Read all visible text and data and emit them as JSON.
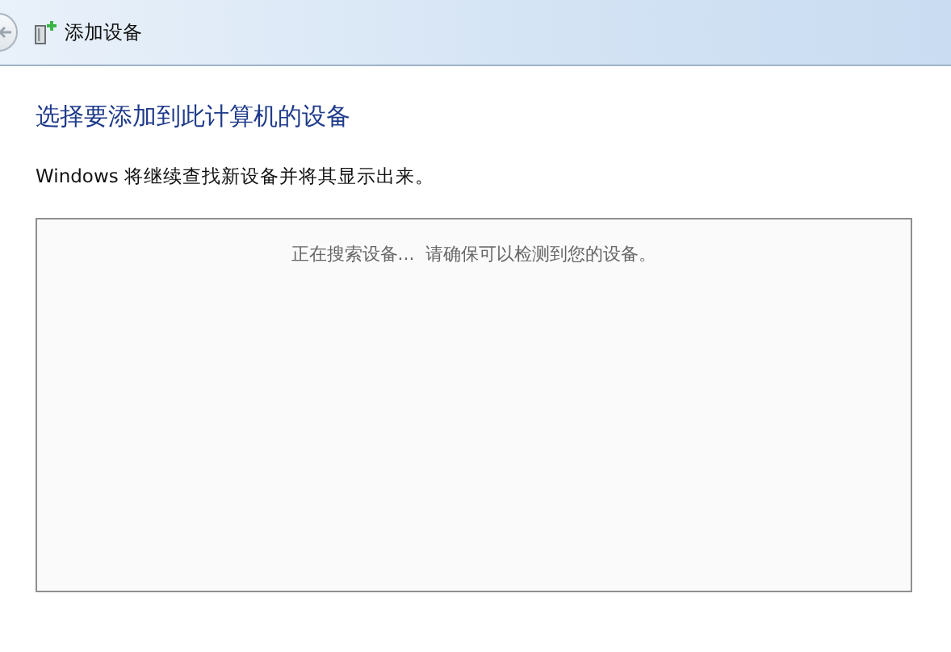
{
  "window": {
    "title": "添加设备"
  },
  "heading": "选择要添加到此计算机的设备",
  "description": "Windows 将继续查找新设备并将其显示出来。",
  "device_list": {
    "status": "正在搜索设备...  请确保可以检测到您的设备。"
  }
}
